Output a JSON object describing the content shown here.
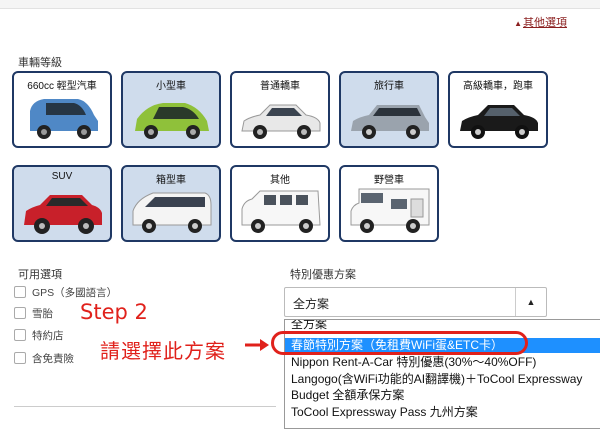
{
  "more_options": "其他選項",
  "vehicle_section": {
    "title": "車輛等級",
    "cards": [
      {
        "label": "660cc 輕型汽車",
        "selected": false,
        "body_color": "#4f88c6"
      },
      {
        "label": "小型車",
        "selected": true,
        "body_color": "#8fc13a"
      },
      {
        "label": "普通轎車",
        "selected": false,
        "body_color": "#f2f2f2"
      },
      {
        "label": "旅行車",
        "selected": true,
        "body_color": "#9aa3ad"
      },
      {
        "label": "高級轎車，跑車",
        "selected": false,
        "body_color": "#1a1a1a"
      },
      {
        "label": "SUV",
        "selected": true,
        "body_color": "#c8202a"
      },
      {
        "label": "箱型車",
        "selected": true,
        "body_color": "#f4f4f4"
      },
      {
        "label": "其他",
        "selected": false,
        "body_color": "#f7f7f7"
      },
      {
        "label": "野營車",
        "selected": false,
        "body_color": "#f7f7f7"
      }
    ]
  },
  "options_section": {
    "title": "可用選項",
    "items": [
      "GPS（多國語言）",
      "雪胎",
      "特約店",
      "含免責險"
    ]
  },
  "plan_section": {
    "title": "特別優惠方案",
    "selected_value": "全方案",
    "options": [
      "全方案",
      "春節特別方案（免租費WiFi蛋&ETC卡）",
      "Nippon Rent-A-Car 特別優惠(30%～40%OFF)",
      "Langogo(含WiFi功能的AI翻譯機)＋ToCool Expressway",
      "Budget 全額承保方案",
      "ToCool Expressway Pass 九州方案"
    ],
    "highlighted_index": 1
  },
  "annotation": {
    "step": "Step 2",
    "instruction": "請選擇此方案",
    "accent_color": "#e0211b"
  }
}
